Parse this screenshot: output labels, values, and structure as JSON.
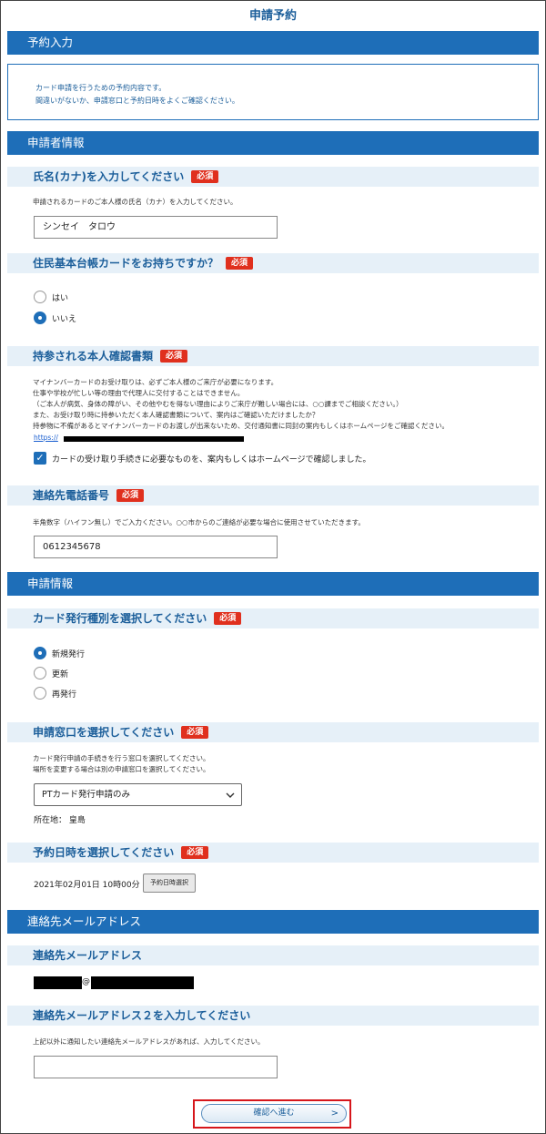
{
  "page_title": "申請予約",
  "reservation": {
    "header": "予約入力",
    "notice_line1": "カード申請を行うための予約内容です。",
    "notice_line2": "間違いがないか、申請窓口と予約日時をよくご確認ください。"
  },
  "required_badge": "必須",
  "applicant": {
    "header": "申請者情報",
    "name": {
      "title": "氏名(カナ)を入力してください",
      "description": "申請されるカードのご本人様の氏名（カナ）を入力してください。",
      "value": "シンセイ　タロウ"
    },
    "resident_card": {
      "title": "住民基本台帳カードをお持ちですか？",
      "options": [
        "はい",
        "いいえ"
      ],
      "selected": "いいえ"
    },
    "id_documents": {
      "title": "持参される本人確認書類",
      "lines": [
        "マイナンバーカードのお受け取りは、必ずご本人様のご来庁が必要になります。",
        "仕事や学校が忙しい等の理由で代理人に交付することはできません。",
        "（ご本人が病気、身体の障がい、その他やむを得ない理由によりご来庁が難しい場合には、○○課までご相談ください。）",
        "また、お受け取り時に持参いただく本人確認書類について、案内はご確認いただけましたか？",
        "持参物に不備があるとマイナンバーカードのお渡しが出来ないため、交付通知書に同封の案内もしくはホームページをご確認ください。"
      ],
      "link_prefix": "https://",
      "check_label": "カードの受け取り手続きに必要なものを、案内もしくはホームページで確認しました。",
      "checked": true
    },
    "phone": {
      "title": "連絡先電話番号",
      "description": "半角数字（ハイフン無し）でご入力ください。○○市からのご連絡が必要な場合に使用させていただきます。",
      "value": "0612345678"
    }
  },
  "application": {
    "header": "申請情報",
    "card_type": {
      "title": "カード発行種別を選択してください",
      "options": [
        "新規発行",
        "更新",
        "再発行"
      ],
      "selected": "新規発行"
    },
    "counter": {
      "title": "申請窓口を選択してください",
      "description_line1": "カード発行申請の手続きを行う窓口を選択してください。",
      "description_line2": "場所を変更する場合は別の申請窓口を選択してください。",
      "selected_value": "PTカード発行申請のみ",
      "location": "所在地： 皇島"
    },
    "datetime": {
      "title": "予約日時を選択してください",
      "value": "2021年02月01日 10時00分",
      "button_label": "予約日時選択"
    }
  },
  "contact_email": {
    "header": "連絡先メールアドレス",
    "email": {
      "title": "連絡先メールアドレス",
      "at": "@"
    },
    "email2": {
      "title": "連絡先メールアドレス２を入力してください",
      "description": "上記以外に通知したい連絡先メールアドレスがあれば、入力してください。",
      "value": ""
    }
  },
  "confirm_button": {
    "label": "確認へ進む",
    "chevron": ">"
  },
  "colors": {
    "primary": "#1e6eb8",
    "required": "#e0301e",
    "highlight": "#d6161b"
  }
}
